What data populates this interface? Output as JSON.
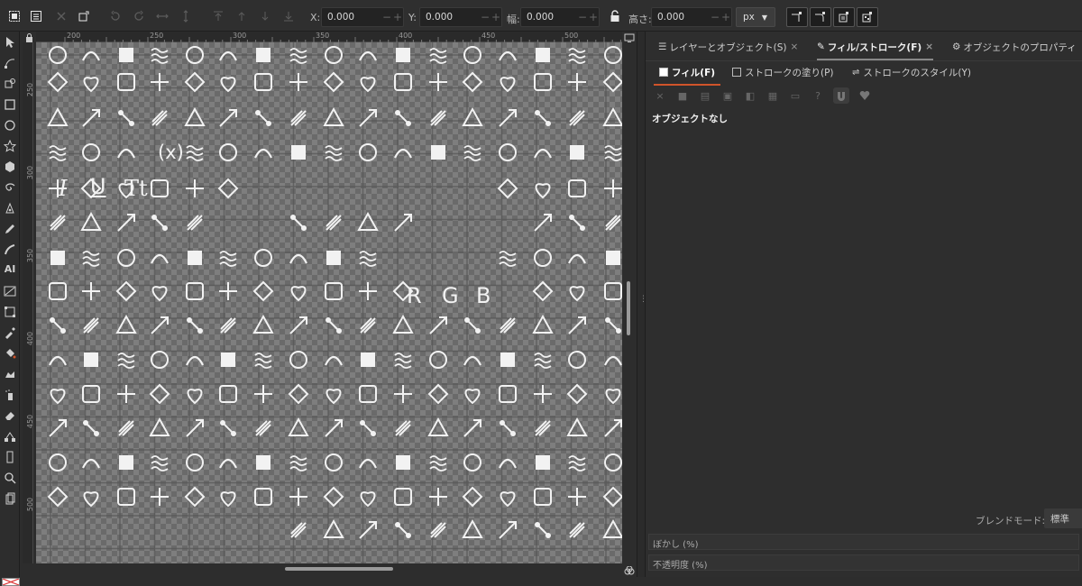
{
  "toolbar": {
    "x_label": "X:",
    "x_value": "0.000",
    "y_label": "Y:",
    "y_value": "0.000",
    "w_label": "幅:",
    "w_value": "0.000",
    "h_label": "高さ:",
    "h_value": "0.000",
    "unit": "px"
  },
  "ruler": {
    "h_marks": [
      "200",
      "250",
      "300",
      "350",
      "400",
      "450",
      "500"
    ],
    "v_marks": [
      "250",
      "300",
      "350",
      "400",
      "450",
      "500"
    ]
  },
  "canvas": {
    "letters": [
      "R",
      "G",
      "B"
    ],
    "text_glyphs": [
      "I",
      "U",
      "Tt",
      "(x)"
    ]
  },
  "panel": {
    "tabs": [
      {
        "label": "レイヤーとオブジェクト(S)",
        "close": "×"
      },
      {
        "label": "フィル/ストローク(F)",
        "close": "×"
      },
      {
        "label": "オブジェクトのプロパティ",
        "close": ""
      }
    ],
    "subtabs": [
      "フィル(F)",
      "ストロークの塗り(P)",
      "ストロークのスタイル(Y)"
    ],
    "paint_buttons": [
      "×",
      "■",
      "▤",
      "▣",
      "◧",
      "▦",
      "▭",
      "?"
    ],
    "no_object": "オブジェクトなし",
    "blend_label": "ブレンドモード:",
    "blend_value": "標準",
    "blur_label": "ぼかし (%)",
    "opacity_label": "不透明度 (%)"
  },
  "colors": {
    "accent": "#d0542a",
    "canvas_bg": "#6a6a6a",
    "panel_bg": "#2e2e2e"
  }
}
